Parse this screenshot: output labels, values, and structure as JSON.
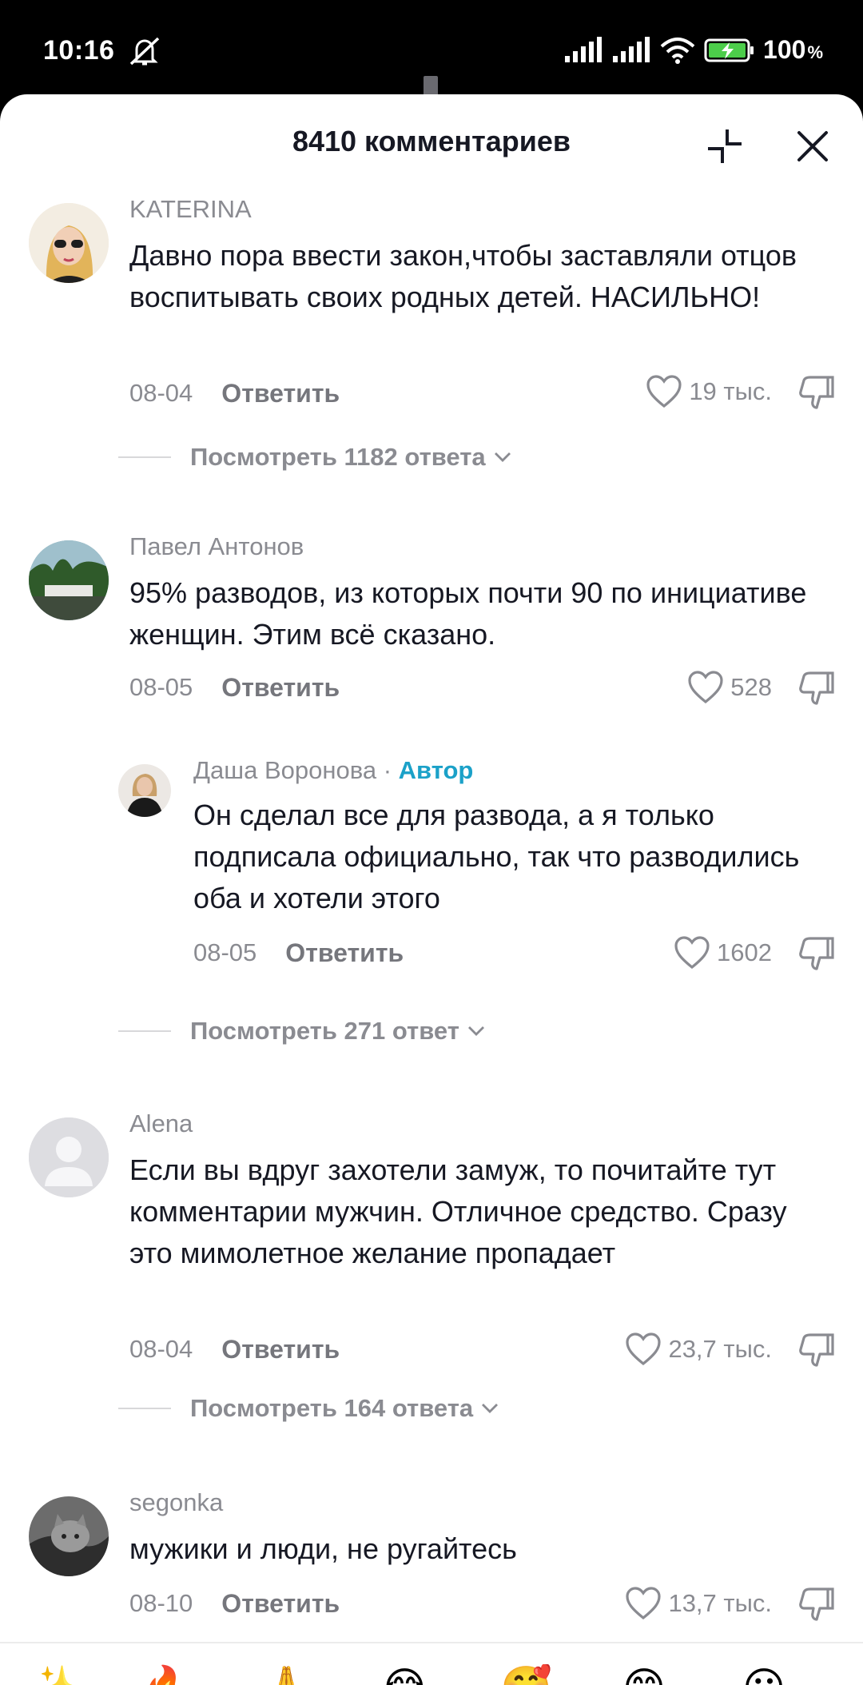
{
  "status_bar": {
    "time": "10:16",
    "battery": "100",
    "battery_unit": "%"
  },
  "header": {
    "title": "8410 комментариев"
  },
  "comments": [
    {
      "username": "KATERINA",
      "text": "Давно пора ввести закон,чтобы заставляли отцов воспитывать своих родных детей. НАСИЛЬНО!",
      "date": "08-04",
      "reply_label": "Ответить",
      "likes": "19 тыс.",
      "view_replies": "Посмотреть 1182 ответа"
    },
    {
      "username": "Павел Антонов",
      "text": "95% разводов, из которых почти 90 по инициативе женщин. Этим всё сказано.",
      "date": "08-05",
      "reply_label": "Ответить",
      "likes": "528",
      "reply": {
        "username": "Даша Воронова",
        "separator": " · ",
        "author_tag": "Автор",
        "text": "Он сделал все для развода, а я только подписала официально, так что разводились оба и хотели этого",
        "date": "08-05",
        "reply_label": "Ответить",
        "likes": "1602"
      },
      "view_replies": "Посмотреть 271 ответ"
    },
    {
      "username": "Alena",
      "text": "Если вы вдруг захотели замуж, то почитайте тут комментарии мужчин. Отличное средство. Сразу это мимолетное желание пропадает",
      "date": "08-04",
      "reply_label": "Ответить",
      "likes": "23,7 тыс.",
      "view_replies": "Посмотреть 164 ответа"
    },
    {
      "username": "segonka",
      "text": "мужики и люди, не ругайтесь",
      "date": "08-10",
      "reply_label": "Ответить",
      "likes": "13,7 тыс."
    }
  ],
  "emoji_bar": [
    "✨",
    "🔥",
    "🙏",
    "😂",
    "🥰",
    "😊",
    "😮"
  ],
  "colors": {
    "text": "#161823",
    "muted": "#8a8b91",
    "author": "#1ba1c8"
  }
}
